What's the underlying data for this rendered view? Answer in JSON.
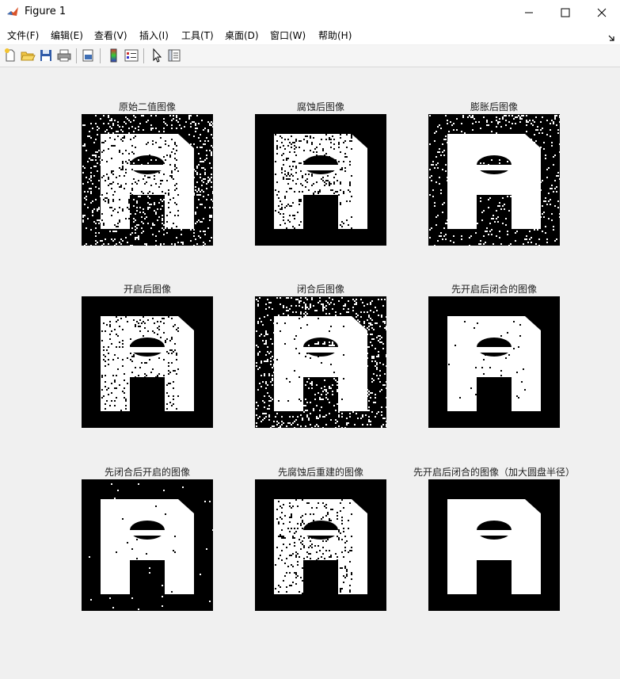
{
  "window": {
    "title": "Figure 1",
    "minimize": "—",
    "maximize": "☐",
    "close": "✕"
  },
  "menu": [
    {
      "label": "文件(F)"
    },
    {
      "label": "编辑(E)"
    },
    {
      "label": "查看(V)"
    },
    {
      "label": "插入(I)"
    },
    {
      "label": "工具(T)"
    },
    {
      "label": "桌面(D)"
    },
    {
      "label": "窗口(W)"
    },
    {
      "label": "帮助(H)"
    }
  ],
  "toolbar_icons": [
    "new-figure-icon",
    "open-icon",
    "save-icon",
    "print-icon",
    "print-preview-icon",
    "colorbar-icon",
    "legend-icon",
    "pointer-icon",
    "property-editor-icon"
  ],
  "subplots": [
    {
      "title": "原始二值图像",
      "variant": "original"
    },
    {
      "title": "腐蚀后图像",
      "variant": "eroded"
    },
    {
      "title": "膨胀后图像",
      "variant": "dilated"
    },
    {
      "title": "开启后图像",
      "variant": "opened"
    },
    {
      "title": "闭合后图像",
      "variant": "closed"
    },
    {
      "title": "先开启后闭合的图像",
      "variant": "open-close"
    },
    {
      "title": "先闭合后开启的图像",
      "variant": "close-open"
    },
    {
      "title": "先腐蚀后重建的图像",
      "variant": "reconstructed"
    },
    {
      "title": "先开启后闭合的图像（加大圆盘半径）",
      "variant": "open-close-large"
    }
  ],
  "colors": {
    "figure_bg": "#f0f0f0",
    "image_fg": "#ffffff",
    "image_bg": "#000000"
  }
}
